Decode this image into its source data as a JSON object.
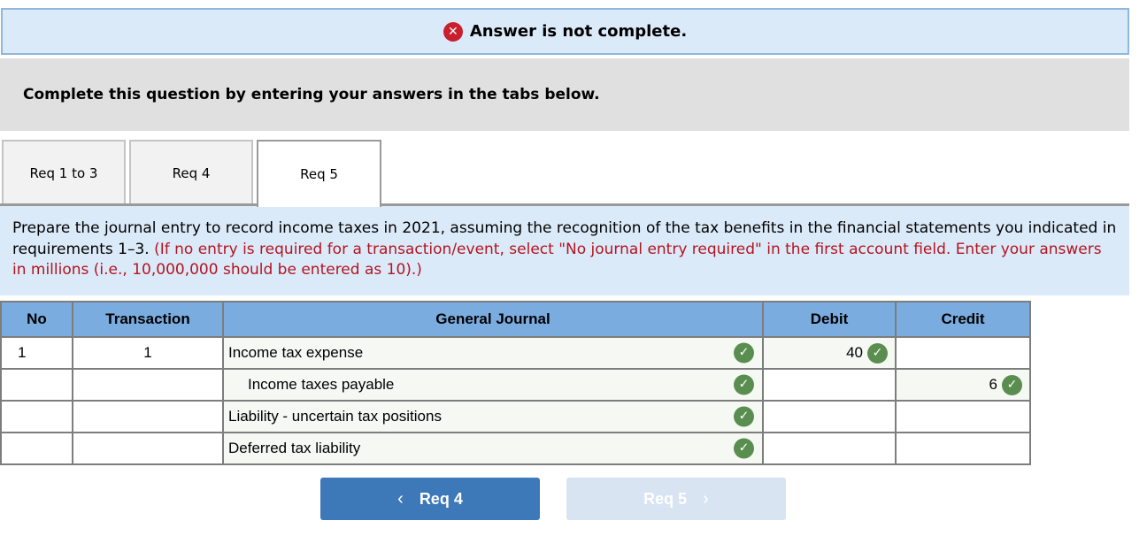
{
  "banner": {
    "icon": "x-circle-icon",
    "text": "Answer is not complete.",
    "icon_color": "#c8202e"
  },
  "instruction": "Complete this question by entering your answers in the tabs below.",
  "tabs": [
    {
      "label": "Req 1 to 3",
      "active": false
    },
    {
      "label": "Req 4",
      "active": false
    },
    {
      "label": "Req 5",
      "active": true
    }
  ],
  "prompt": {
    "main": "Prepare the journal entry to record income taxes in 2021, assuming the recognition of the tax benefits in the financial statements you indicated in requirements 1–3.",
    "note": "(If no entry is required for a transaction/event, select \"No journal entry required\" in the first account field. Enter your answers in millions (i.e., 10,000,000 should be entered as 10).)"
  },
  "journal": {
    "headers": [
      "No",
      "Transaction",
      "General Journal",
      "Debit",
      "Credit"
    ],
    "rows": [
      {
        "no": "1",
        "transaction": "1",
        "account": "Income tax expense",
        "account_correct": true,
        "debit": "40",
        "debit_correct": true,
        "credit": "",
        "credit_correct": false
      },
      {
        "no": "",
        "transaction": "",
        "account": "Income taxes payable",
        "account_correct": true,
        "debit": "",
        "debit_correct": false,
        "credit": "6",
        "credit_correct": true
      },
      {
        "no": "",
        "transaction": "",
        "account": "Liability - uncertain tax positions",
        "account_correct": true,
        "debit": "",
        "debit_correct": false,
        "credit": "",
        "credit_correct": false
      },
      {
        "no": "",
        "transaction": "",
        "account": "Deferred tax liability",
        "account_correct": true,
        "debit": "",
        "debit_correct": false,
        "credit": "",
        "credit_correct": false
      }
    ],
    "check_color": "#5a8e50"
  },
  "nav": {
    "prev_label": "Req 4",
    "next_label": "Req 5",
    "prev_color": "#3d78b9",
    "next_color": "#d8e4f2",
    "next_disabled": true
  }
}
